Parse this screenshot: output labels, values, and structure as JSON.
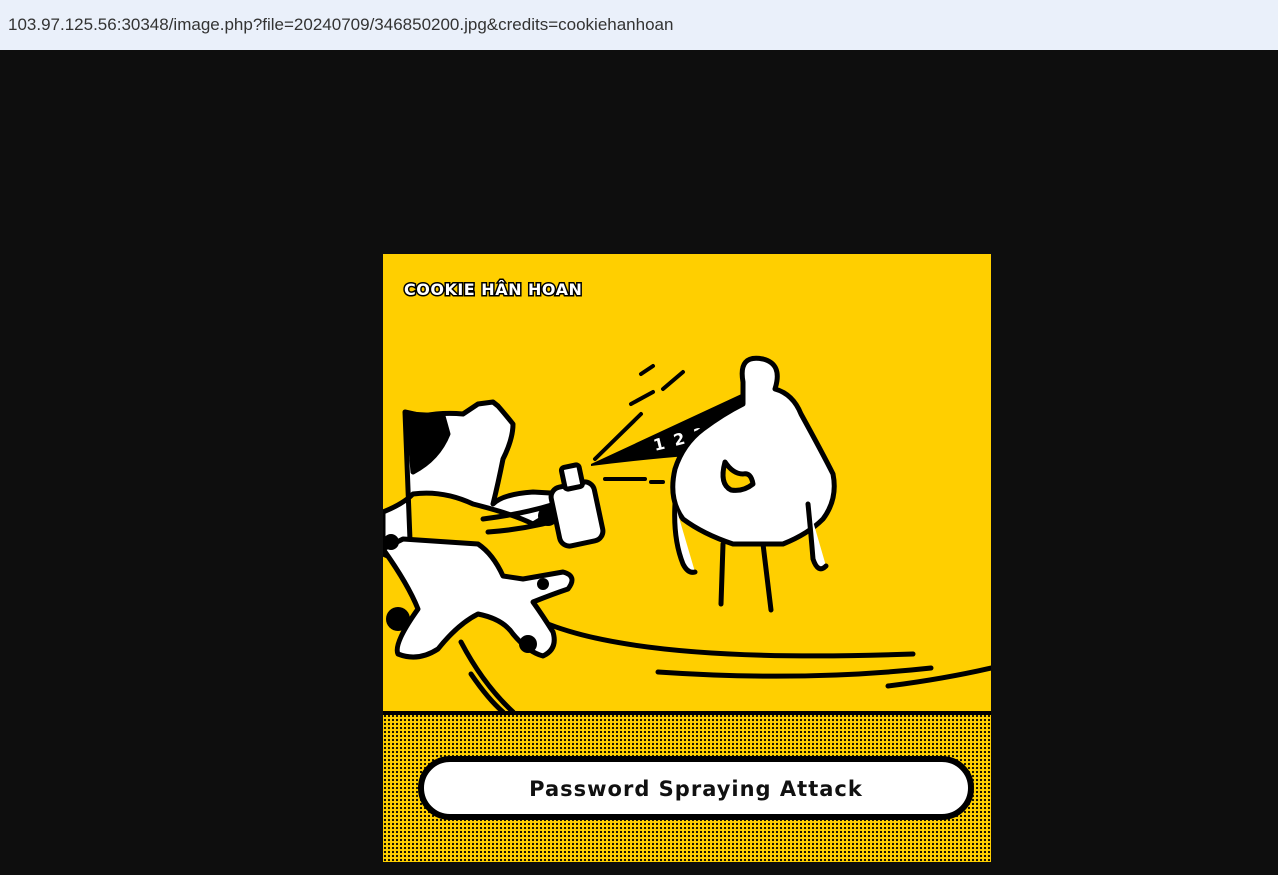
{
  "browser": {
    "url": "103.97.125.56:30348/image.php?file=20240709/346850200.jpg&credits=cookiehanhoan"
  },
  "image": {
    "brand_text": "COOKIE HÂN HOAN",
    "spray_numbers": "1 2 3 4 5 6",
    "caption": "Password Spraying Attack",
    "colors": {
      "background": "#ffcf00",
      "page_background": "#0e0e0e",
      "ink": "#000000",
      "url_bar": "#eaf0fa"
    },
    "icons": [
      "cat-character",
      "chicken-character",
      "spray-can-icon"
    ]
  }
}
